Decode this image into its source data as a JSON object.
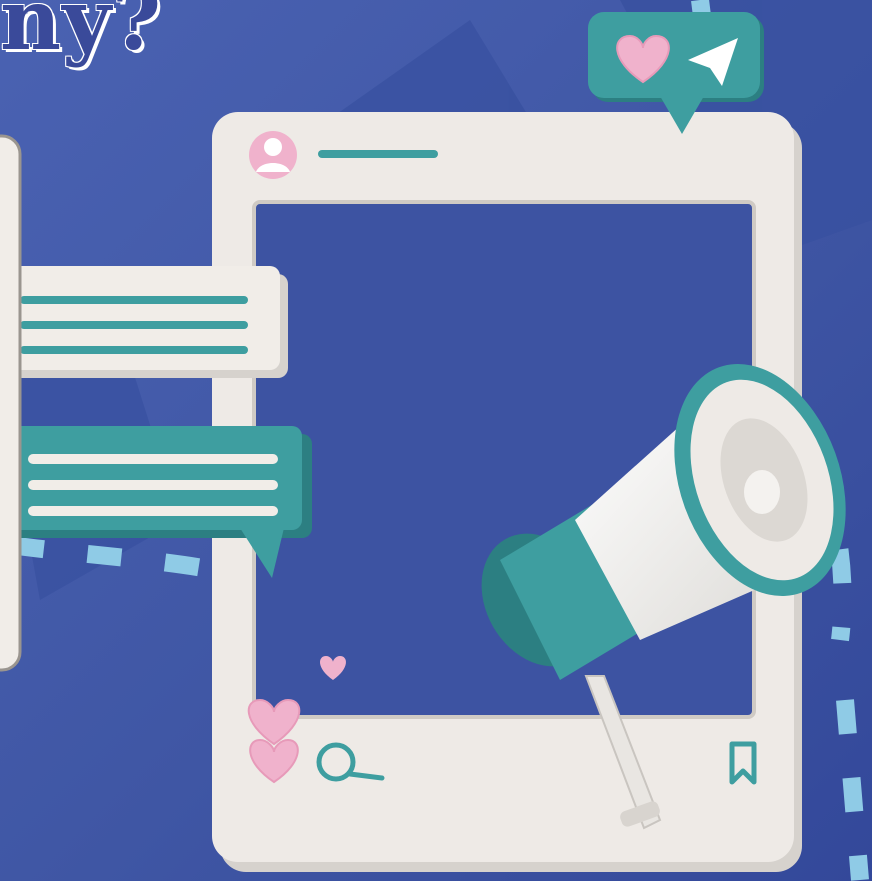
{
  "heading": {
    "text": "ny?"
  },
  "colors": {
    "background": "#3f56a4",
    "background_dark": "#2e4191",
    "title_text": "#3a4a9a",
    "frame": "#eeeae6",
    "teal": "#3e9ea0",
    "teal_dark": "#2c7f82",
    "pink": "#f0b2cc",
    "dash": "#8fcbe6"
  },
  "icons": {
    "avatar": "user-avatar-icon",
    "heart": "heart-icon",
    "send": "paper-plane-icon",
    "comment": "comment-bubble-icon",
    "bookmark": "bookmark-icon",
    "megaphone": "megaphone-icon"
  }
}
